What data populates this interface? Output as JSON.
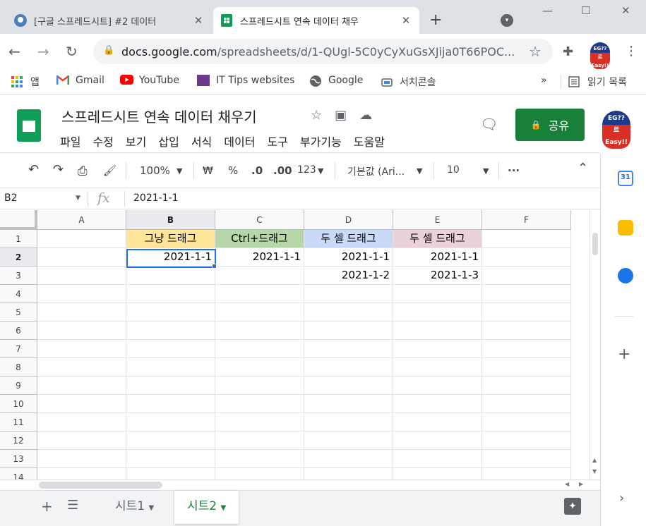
{
  "browser": {
    "tabs": [
      {
        "title": "[구글 스프레드시트] #2 데이터",
        "active": false
      },
      {
        "title": "스프레드시트 연속 데이터 채우",
        "active": true
      }
    ],
    "new_tab": "+",
    "url_host": "docs.google.com",
    "url_path": "/spreadsheets/d/1-QUgl-5C0yCyXuGsXJija0T66POC...",
    "profile_top": "EG??",
    "profile_bottom": "르 Easy!!"
  },
  "bookmarks": [
    {
      "label": "앱",
      "icon": "apps-icon"
    },
    {
      "label": "Gmail",
      "icon": "gmail-icon"
    },
    {
      "label": "YouTube",
      "icon": "youtube-icon"
    },
    {
      "label": "IT Tips websites",
      "icon": "folder-icon"
    },
    {
      "label": "Google",
      "icon": "globe-icon"
    },
    {
      "label": "서치콘솔",
      "icon": "searchconsole-icon"
    }
  ],
  "bookmarks_more": "»",
  "reading_list": "읽기 목록",
  "sheets": {
    "doc_title": "스프레드시트 연속 데이터 채우기",
    "menu": [
      "파일",
      "수정",
      "보기",
      "삽입",
      "서식",
      "데이터",
      "도구",
      "부가기능",
      "도움말"
    ],
    "share_label": "공유"
  },
  "format_toolbar": {
    "zoom": "100%",
    "currency": "₩",
    "percent": "%",
    "decrease_decimals": ".0",
    "increase_decimals": ".00",
    "more_formats": "123",
    "font": "기본값 (Ari...",
    "font_size": "10"
  },
  "formula_bar": {
    "name_box": "B2",
    "fx": "fx",
    "value": "2021-1-1"
  },
  "grid": {
    "columns": [
      "A",
      "B",
      "C",
      "D",
      "E",
      "F"
    ],
    "selected_column": "B",
    "rows": [
      "1",
      "2",
      "3",
      "4",
      "5",
      "6",
      "7",
      "8",
      "9",
      "10",
      "11",
      "12",
      "13",
      "14"
    ],
    "selected_row": "2",
    "headers": {
      "B1": {
        "text": "그냥 드래그",
        "color": "#ffe599"
      },
      "C1": {
        "text": "Ctrl+드래그",
        "color": "#b6d7a8"
      },
      "D1": {
        "text": "두 셀 드래그",
        "color": "#c9daf8"
      },
      "E1": {
        "text": "두 셀 드래그",
        "color": "#ead1dc"
      }
    },
    "values": {
      "B2": "2021-1-1",
      "C2": "2021-1-1",
      "D2": "2021-1-1",
      "E2": "2021-1-1",
      "D3": "2021-1-2",
      "E3": "2021-1-3"
    },
    "selected_cell": "B2"
  },
  "sheet_tabs": [
    "시트1",
    "시트2"
  ],
  "active_sheet": "시트2"
}
